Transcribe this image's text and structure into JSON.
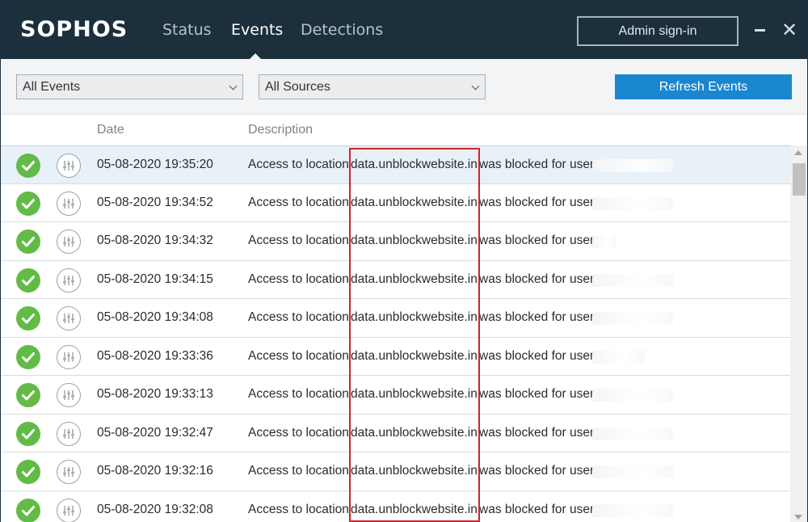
{
  "header": {
    "logo": "SOPHOS",
    "tabs": [
      {
        "label": "Status",
        "active": false
      },
      {
        "label": "Events",
        "active": true
      },
      {
        "label": "Detections",
        "active": false
      }
    ],
    "admin_button": "Admin sign-in",
    "minimize_icon": "minimize-icon",
    "close_icon": "close-icon",
    "colors": {
      "background": "#1b2f3c",
      "accent": "#1a86d0",
      "success": "#62bb46",
      "highlight": "#d3222a"
    }
  },
  "filters": {
    "event_filter": "All Events",
    "source_filter": "All Sources",
    "refresh_button": "Refresh Events"
  },
  "table": {
    "columns": {
      "date": "Date",
      "description": "Description"
    },
    "rows": [
      {
        "date": "05-08-2020 19:35:20",
        "pre": "Access to location",
        "location": "data.unblockwebsite.in",
        "post": "was blocked for user",
        "status_icon": "check-circle-icon",
        "details_icon": "sliders-icon",
        "selected": true
      },
      {
        "date": "05-08-2020 19:34:52",
        "pre": "Access to location",
        "location": "data.unblockwebsite.in",
        "post": "was blocked for user",
        "status_icon": "check-circle-icon",
        "details_icon": "sliders-icon",
        "selected": false
      },
      {
        "date": "05-08-2020 19:34:32",
        "pre": "Access to location",
        "location": "data.unblockwebsite.in",
        "post": "was blocked for user",
        "status_icon": "check-circle-icon",
        "details_icon": "sliders-icon",
        "selected": false
      },
      {
        "date": "05-08-2020 19:34:15",
        "pre": "Access to location",
        "location": "data.unblockwebsite.in",
        "post": "was blocked for user",
        "status_icon": "check-circle-icon",
        "details_icon": "sliders-icon",
        "selected": false
      },
      {
        "date": "05-08-2020 19:34:08",
        "pre": "Access to location",
        "location": "data.unblockwebsite.in",
        "post": "was blocked for user",
        "status_icon": "check-circle-icon",
        "details_icon": "sliders-icon",
        "selected": false
      },
      {
        "date": "05-08-2020 19:33:36",
        "pre": "Access to location",
        "location": "data.unblockwebsite.in",
        "post": "was blocked for user",
        "status_icon": "check-circle-icon",
        "details_icon": "sliders-icon",
        "selected": false
      },
      {
        "date": "05-08-2020 19:33:13",
        "pre": "Access to location",
        "location": "data.unblockwebsite.in",
        "post": "was blocked for user",
        "status_icon": "check-circle-icon",
        "details_icon": "sliders-icon",
        "selected": false
      },
      {
        "date": "05-08-2020 19:32:47",
        "pre": "Access to location",
        "location": "data.unblockwebsite.in",
        "post": "was blocked for user",
        "status_icon": "check-circle-icon",
        "details_icon": "sliders-icon",
        "selected": false
      },
      {
        "date": "05-08-2020 19:32:16",
        "pre": "Access to location",
        "location": "data.unblockwebsite.in",
        "post": "was blocked for user",
        "status_icon": "check-circle-icon",
        "details_icon": "sliders-icon",
        "selected": false
      },
      {
        "date": "05-08-2020 19:32:08",
        "pre": "Access to location",
        "location": "data.unblockwebsite.in",
        "post": "was blocked for user",
        "status_icon": "check-circle-icon",
        "details_icon": "sliders-icon",
        "selected": false
      }
    ]
  }
}
